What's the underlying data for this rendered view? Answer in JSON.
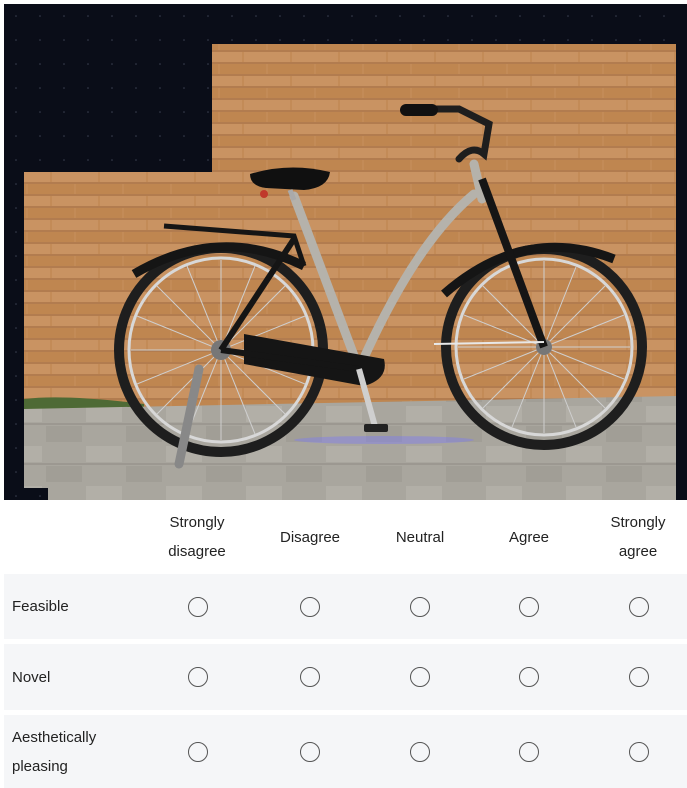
{
  "image": {
    "subject": "bicycle-photo",
    "colors": {
      "background": "#0a0d18",
      "wall": "#c08a55",
      "ground": "#a7a49c",
      "frame": "#b5b2ab",
      "tires": "#1e1e1e"
    }
  },
  "survey": {
    "columns": [
      {
        "label": "Strongly\ndisagree"
      },
      {
        "label": "Disagree"
      },
      {
        "label": "Neutral"
      },
      {
        "label": "Agree"
      },
      {
        "label": "Strongly\nagree"
      }
    ],
    "rows": [
      {
        "label": "Feasible"
      },
      {
        "label": "Novel"
      },
      {
        "label": "Aesthetically\npleasing"
      }
    ],
    "colors": {
      "row_background": "#f5f6f8",
      "radio_border": "#555555"
    }
  }
}
